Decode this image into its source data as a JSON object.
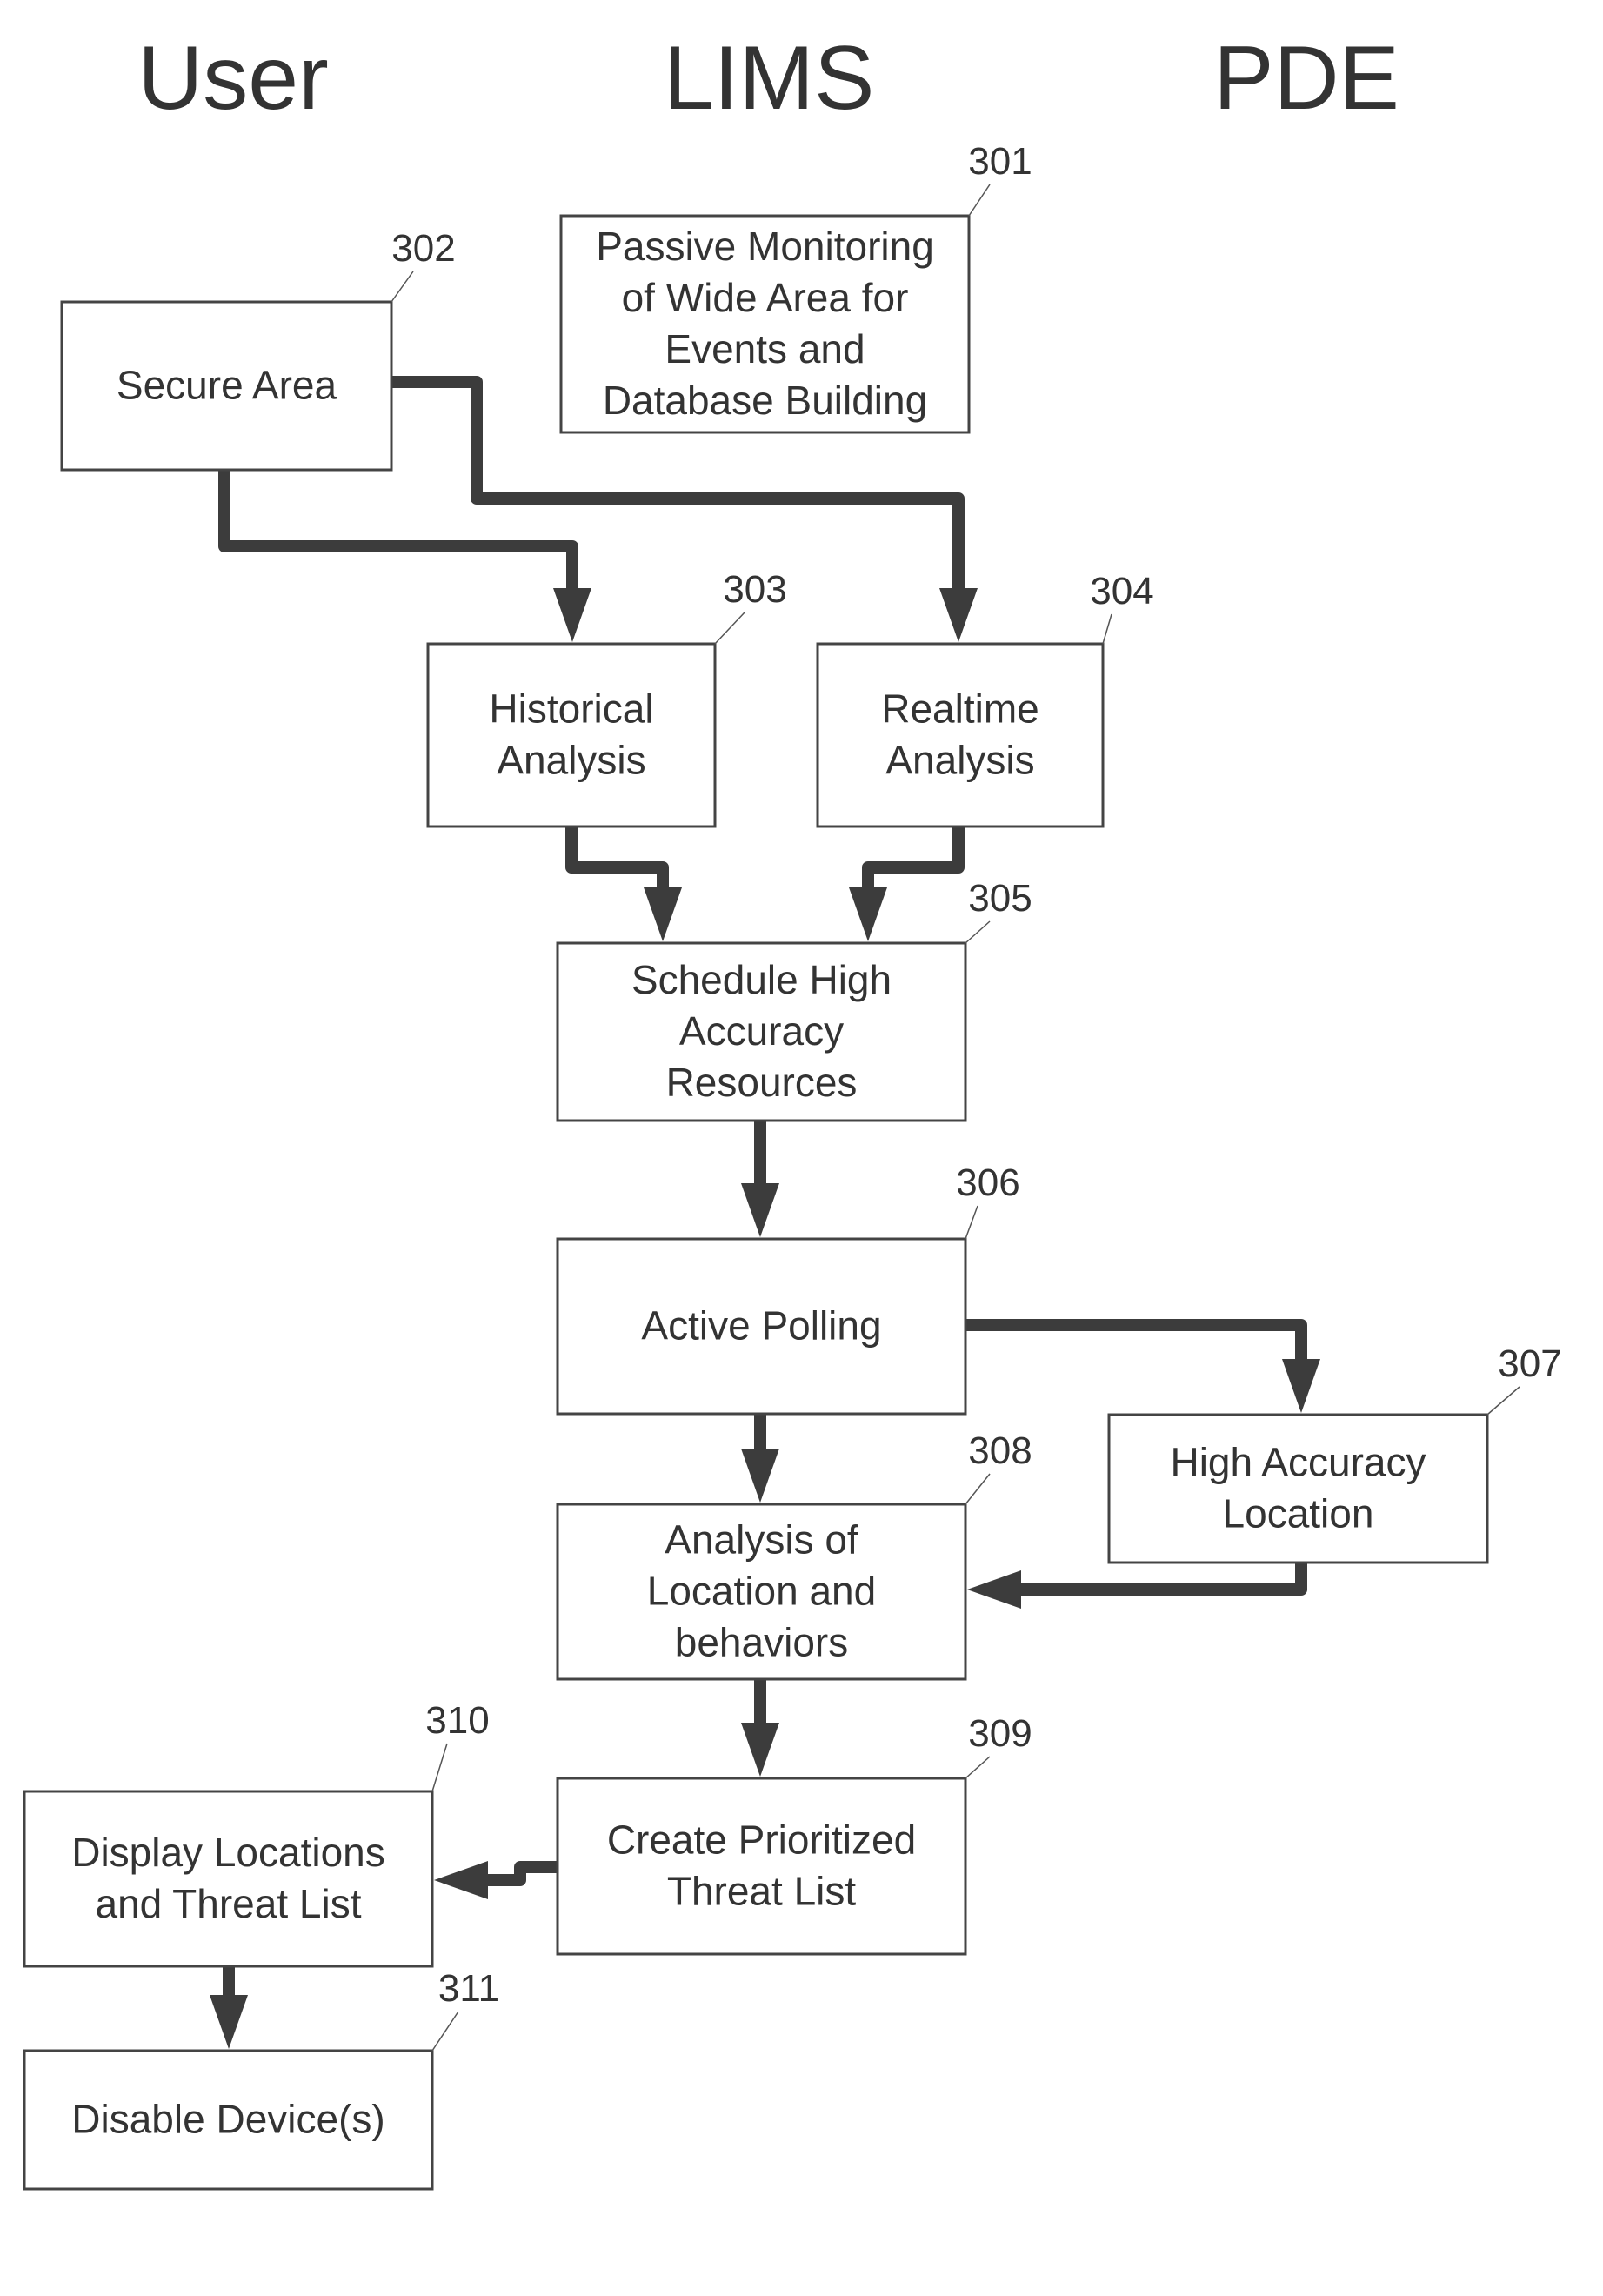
{
  "lanes": [
    {
      "id": "user",
      "title": "User"
    },
    {
      "id": "lims",
      "title": "LIMS"
    },
    {
      "id": "pde",
      "title": "PDE"
    }
  ],
  "nodes": [
    {
      "ref": "301",
      "lines": [
        "Passive Monitoring",
        "of Wide Area for",
        "Events and",
        "Database Building"
      ]
    },
    {
      "ref": "302",
      "lines": [
        "Secure Area"
      ]
    },
    {
      "ref": "303",
      "lines": [
        "Historical",
        "Analysis"
      ]
    },
    {
      "ref": "304",
      "lines": [
        "Realtime",
        "Analysis"
      ]
    },
    {
      "ref": "305",
      "lines": [
        "Schedule High",
        "Accuracy",
        "Resources"
      ]
    },
    {
      "ref": "306",
      "lines": [
        "Active Polling"
      ]
    },
    {
      "ref": "307",
      "lines": [
        "High Accuracy",
        "Location"
      ]
    },
    {
      "ref": "308",
      "lines": [
        "Analysis of",
        "Location and",
        "behaviors"
      ]
    },
    {
      "ref": "309",
      "lines": [
        "Create Prioritized",
        "Threat List"
      ]
    },
    {
      "ref": "310",
      "lines": [
        "Display Locations",
        "and Threat List"
      ]
    },
    {
      "ref": "311",
      "lines": [
        "Disable Device(s)"
      ]
    }
  ],
  "edges": [
    {
      "from": "302",
      "to": "303"
    },
    {
      "from": "302",
      "to": "304"
    },
    {
      "from": "303",
      "to": "305"
    },
    {
      "from": "304",
      "to": "305"
    },
    {
      "from": "305",
      "to": "306"
    },
    {
      "from": "306",
      "to": "307"
    },
    {
      "from": "306",
      "to": "308"
    },
    {
      "from": "307",
      "to": "308"
    },
    {
      "from": "308",
      "to": "309"
    },
    {
      "from": "309",
      "to": "310"
    },
    {
      "from": "310",
      "to": "311"
    }
  ]
}
